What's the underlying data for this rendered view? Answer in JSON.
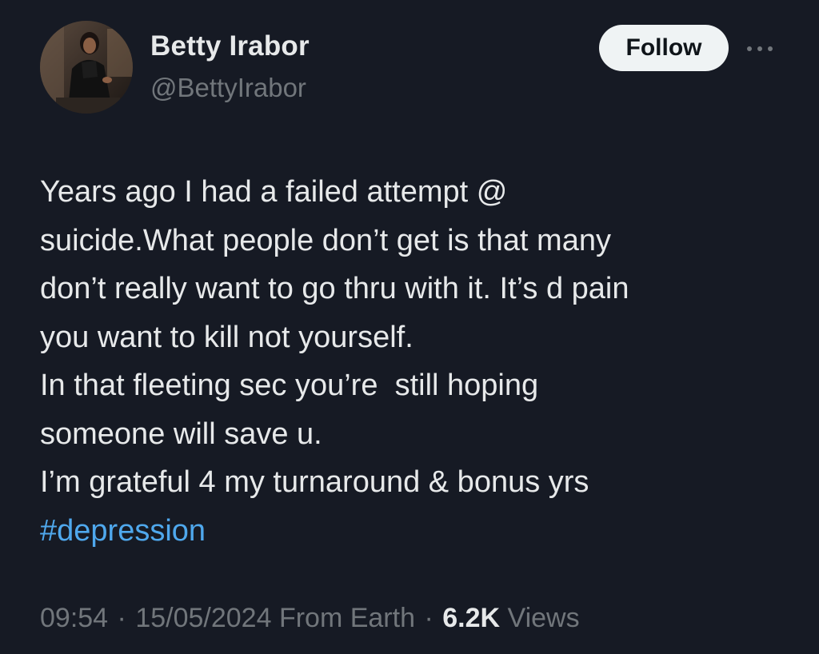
{
  "author": {
    "display_name": "Betty Irabor",
    "handle": "@BettyIrabor"
  },
  "actions": {
    "follow_label": "Follow",
    "more_icon": "more-horizontal-icon"
  },
  "tweet": {
    "lines": [
      "Years ago I had a failed attempt @",
      "suicide.What people don’t get is that many",
      "don’t really want to go thru with it. It’s d pain",
      "you want to kill not yourself.",
      "In that fleeting sec you’re  still hoping",
      "someone will save u.",
      "I’m grateful 4 my turnaround & bonus yrs"
    ],
    "hashtag": "#depression"
  },
  "meta": {
    "time": "09:54",
    "separator": "·",
    "date": "15/05/2024",
    "source": "From Earth",
    "views_count": "6.2K",
    "views_label": "Views"
  },
  "colors": {
    "background": "#161a24",
    "text_primary": "#e7e9ea",
    "text_secondary": "#71767b",
    "link": "#4fa8ed",
    "follow_bg": "#eff3f4"
  }
}
